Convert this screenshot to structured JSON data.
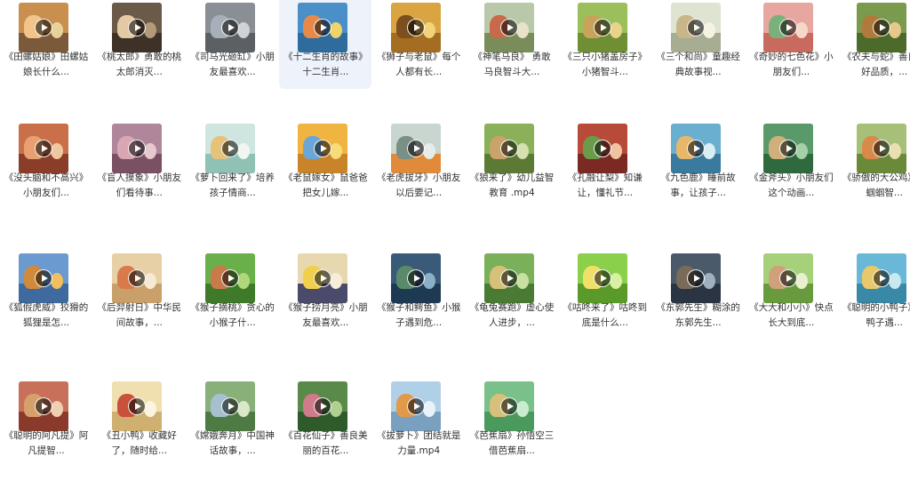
{
  "rows": [
    [
      {
        "label": "《田螺姑娘》田螺姑娘长什么...",
        "palette": [
          "#c98f4e",
          "#e7d39a",
          "#7a5a3a",
          "#f2c38a"
        ]
      },
      {
        "label": "《桃太郎》勇敢的桃太郎消灭...",
        "palette": [
          "#6b5a48",
          "#b49a7a",
          "#3e3228",
          "#e4c9a4"
        ]
      },
      {
        "label": "《司马光砸缸》小朋友最喜欢...",
        "palette": [
          "#8a8f96",
          "#cfd3d6",
          "#5c5f63",
          "#a7b0b8"
        ]
      },
      {
        "label": "《十二生肖的故事》 十二生肖...",
        "palette": [
          "#4a8fc7",
          "#f0d46a",
          "#2f6c9e",
          "#e8894a"
        ]
      },
      {
        "label": "《狮子与老鼠》每个人都有长...",
        "palette": [
          "#d9a441",
          "#f3d37a",
          "#a46d22",
          "#7b4f1e"
        ]
      },
      {
        "label": "《神笔马良》 勇敢马良智斗大...",
        "palette": [
          "#b9c8a8",
          "#e8e2c8",
          "#7a8c5a",
          "#c86a4a"
        ]
      },
      {
        "label": "《三只小猪盖房子》小猪智斗...",
        "palette": [
          "#9bbf5a",
          "#e9d38a",
          "#6e8f34",
          "#c9a35a"
        ]
      },
      {
        "label": "《三个和尚》童趣经典故事视...",
        "palette": [
          "#dfe3d2",
          "#f6f2e4",
          "#a6ad92",
          "#c9b58a"
        ]
      },
      {
        "label": "《奇妙的七色花》小朋友们...",
        "palette": [
          "#e8a6a0",
          "#f4d9c8",
          "#c96a5e",
          "#7ab07a"
        ]
      },
      {
        "label": "《农夫与蛇》善良是好品质，...",
        "palette": [
          "#7a9a4e",
          "#e6c98a",
          "#4c6a2a",
          "#b07a3a"
        ]
      }
    ],
    [
      {
        "label": "《没头脑和不高兴》小朋友们...",
        "palette": [
          "#c9704a",
          "#f0c8a0",
          "#8a3e2a",
          "#e8a070"
        ]
      },
      {
        "label": "《盲人摸象》小朋友们看待事...",
        "palette": [
          "#b0869a",
          "#e8c8d0",
          "#7a5062",
          "#d9a6b4"
        ]
      },
      {
        "label": "《萝卜回来了》培养孩子情商...",
        "palette": [
          "#cfe6e0",
          "#f2f6f2",
          "#8fc2b4",
          "#e6c27a"
        ]
      },
      {
        "label": "《老鼠嫁女》鼠爸爸把女儿嫁...",
        "palette": [
          "#f0b440",
          "#f8dc7a",
          "#c9842a",
          "#6aa6d6"
        ]
      },
      {
        "label": "《老虎拔牙》小朋友以后要记...",
        "palette": [
          "#c9d6d0",
          "#e6ecea",
          "#e08a3a",
          "#7a8f86"
        ]
      },
      {
        "label": "《狼来了》幼儿益智教育 .mp4",
        "palette": [
          "#8ab05a",
          "#d6e0b0",
          "#5c7a34",
          "#c9a36a"
        ]
      },
      {
        "label": "《孔融让梨》知谦让，懂礼节...",
        "palette": [
          "#b84a3a",
          "#f0c4a0",
          "#7a2a22",
          "#6a9a4a"
        ]
      },
      {
        "label": "《九色鹿》睡前故事，让孩子...",
        "palette": [
          "#6aaed0",
          "#d8eef2",
          "#3a7a9e",
          "#e8b86a"
        ]
      },
      {
        "label": "《金斧头》小朋友们这个动画...",
        "palette": [
          "#5a9a6a",
          "#a6d0a6",
          "#2f6a3e",
          "#d0b07a"
        ]
      },
      {
        "label": "《骄傲的大公鸡》小蝈蝈智...",
        "palette": [
          "#a6c07a",
          "#e8e0b0",
          "#6a8a3a",
          "#d98a4a"
        ]
      }
    ],
    [
      {
        "label": "《狐假虎威》狡猾的狐狸是怎...",
        "palette": [
          "#6a9ad0",
          "#f0c060",
          "#3e6a9e",
          "#d08a3a"
        ]
      },
      {
        "label": "《后羿射日》中华民间故事，...",
        "palette": [
          "#e8d0a6",
          "#f6ead4",
          "#c9a06a",
          "#d97a4a"
        ]
      },
      {
        "label": "《猴子摘桃》贪心的小猴子什...",
        "palette": [
          "#6ab04a",
          "#b0d87a",
          "#3e7a2a",
          "#c97a4a"
        ]
      },
      {
        "label": "《猴子捞月亮》小朋友最喜欢...",
        "palette": [
          "#e8d8b0",
          "#f6eed8",
          "#4a4a6a",
          "#f0d04a"
        ]
      },
      {
        "label": "《猴子和鳄鱼》小猴子遇到危...",
        "palette": [
          "#3a5a7a",
          "#8ab0c8",
          "#1e3a52",
          "#5a8a6a"
        ]
      },
      {
        "label": "《龟兔赛跑》虚心使人进步，...",
        "palette": [
          "#7ab05a",
          "#c8e0a0",
          "#4a7a34",
          "#d6c07a"
        ]
      },
      {
        "label": "《咕咚来了》咕咚到底是什么...",
        "palette": [
          "#8ad04a",
          "#d8f0a0",
          "#5a9a2a",
          "#f0e06a"
        ]
      },
      {
        "label": "《东郭先生》糊涂的东郭先生...",
        "palette": [
          "#4a5a6a",
          "#a0b0c0",
          "#2a3442",
          "#7a6a5a"
        ]
      },
      {
        "label": "《大大和小小》快点长大到底...",
        "palette": [
          "#a6d07a",
          "#e8f0d0",
          "#6a9a3e",
          "#d0a07a"
        ]
      },
      {
        "label": "《聪明的小鸭子》小鸭子遇...",
        "palette": [
          "#6ab8d8",
          "#c8e8f0",
          "#3a88a8",
          "#e8c86a"
        ]
      }
    ],
    [
      {
        "label": "《聪明的阿凡提》阿凡提智...",
        "palette": [
          "#c9705a",
          "#f0d0b0",
          "#8a3a2a",
          "#d6a06a"
        ]
      },
      {
        "label": "《丑小鸭》收藏好了，随时给...",
        "palette": [
          "#f0e0b0",
          "#faf4e0",
          "#d0b070",
          "#c9503a"
        ]
      },
      {
        "label": "《嫦娥奔月》中国神话故事，...",
        "palette": [
          "#8ab07a",
          "#d8e8c8",
          "#4e7a44",
          "#a6c0d0"
        ]
      },
      {
        "label": "《百花仙子》善良美丽的百花...",
        "palette": [
          "#5a8a4a",
          "#b0d090",
          "#2f5a2a",
          "#d07a8a"
        ]
      },
      {
        "label": "《拔萝卜》团结就是力量.mp4",
        "palette": [
          "#b0d0e8",
          "#e8f2f8",
          "#7aa0c0",
          "#e09a4a"
        ]
      },
      {
        "label": "《芭蕉扇》孙悟空三借芭蕉扇...",
        "palette": [
          "#7ac08a",
          "#c8ecd0",
          "#4a9a5e",
          "#d8c07a"
        ]
      }
    ]
  ],
  "selected": {
    "row": 0,
    "col": 3
  }
}
